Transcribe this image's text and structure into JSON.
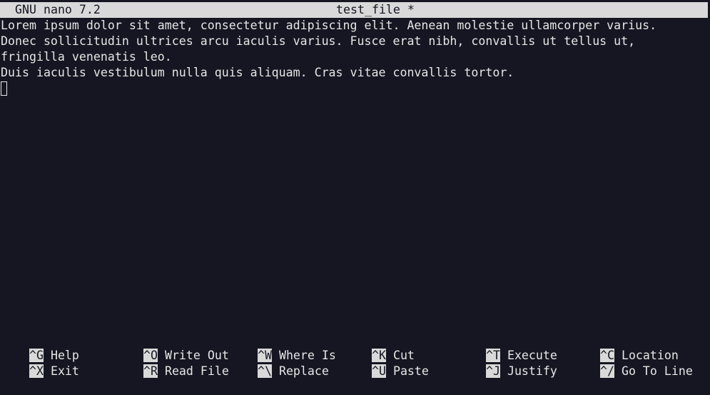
{
  "title_bar": {
    "app_version": "GNU nano 7.2",
    "file_name": "test_file *"
  },
  "editor": {
    "lines": [
      "Lorem ipsum dolor sit amet, consectetur adipiscing elit. Aenean molestie ullamcorper varius.",
      "Donec sollicitudin ultrices arcu iaculis varius. Fusce erat nibh, convallis ut tellus ut,",
      "fringilla venenatis leo.",
      "Duis iaculis vestibulum nulla quis aliquam. Cras vitae convallis tortor."
    ]
  },
  "shortcuts": {
    "row1": [
      {
        "key": "^G",
        "label": "Help"
      },
      {
        "key": "^O",
        "label": "Write Out"
      },
      {
        "key": "^W",
        "label": "Where Is"
      },
      {
        "key": "^K",
        "label": "Cut"
      },
      {
        "key": "^T",
        "label": "Execute"
      },
      {
        "key": "^C",
        "label": "Location"
      }
    ],
    "row2": [
      {
        "key": "^X",
        "label": "Exit"
      },
      {
        "key": "^R",
        "label": "Read File"
      },
      {
        "key": "^\\",
        "label": "Replace"
      },
      {
        "key": "^U",
        "label": "Paste"
      },
      {
        "key": "^J",
        "label": "Justify"
      },
      {
        "key": "^/",
        "label": "Go To Line"
      }
    ]
  },
  "colors": {
    "background": "#161622",
    "title_bar": "#d9d9d9",
    "text": "#e6e6e6"
  }
}
